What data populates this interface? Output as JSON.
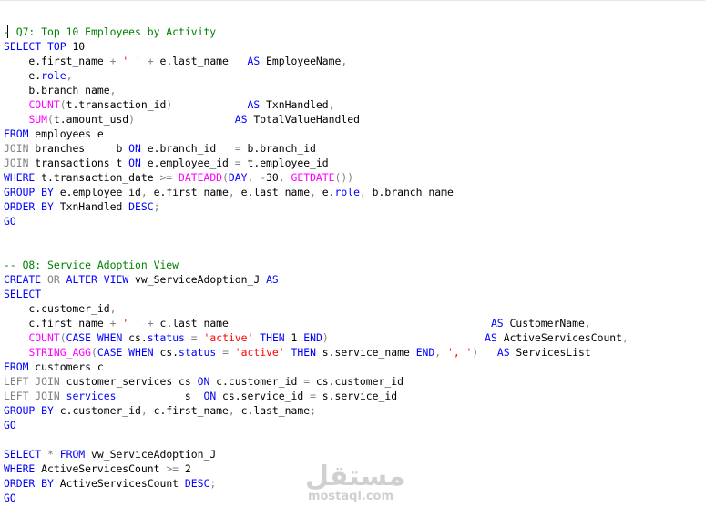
{
  "editor": {
    "watermark": {
      "mark": "مستقل",
      "text": "mostaql.com"
    },
    "lines": [
      [
        {
          "t": "- Q7: Top 10 Employees by Activity",
          "c": "cm"
        }
      ],
      [
        {
          "t": "SELECT",
          "c": "kw"
        },
        {
          "t": " ",
          "c": "tx"
        },
        {
          "t": "TOP",
          "c": "kw"
        },
        {
          "t": " 10",
          "c": "tx"
        }
      ],
      [
        {
          "t": "    e.first_name ",
          "c": "tx"
        },
        {
          "t": "+",
          "c": "op"
        },
        {
          "t": " ",
          "c": "tx"
        },
        {
          "t": "' '",
          "c": "str"
        },
        {
          "t": " ",
          "c": "tx"
        },
        {
          "t": "+",
          "c": "op"
        },
        {
          "t": " e.last_name   ",
          "c": "tx"
        },
        {
          "t": "AS",
          "c": "kw"
        },
        {
          "t": " EmployeeName",
          "c": "tx"
        },
        {
          "t": ",",
          "c": "op"
        }
      ],
      [
        {
          "t": "    e.",
          "c": "tx"
        },
        {
          "t": "role",
          "c": "kw"
        },
        {
          "t": ",",
          "c": "op"
        }
      ],
      [
        {
          "t": "    b.branch_name",
          "c": "tx"
        },
        {
          "t": ",",
          "c": "op"
        }
      ],
      [
        {
          "t": "    ",
          "c": "tx"
        },
        {
          "t": "COUNT",
          "c": "fn"
        },
        {
          "t": "(",
          "c": "op"
        },
        {
          "t": "t.transaction_id",
          "c": "tx"
        },
        {
          "t": ")",
          "c": "op"
        },
        {
          "t": "            ",
          "c": "tx"
        },
        {
          "t": "AS",
          "c": "kw"
        },
        {
          "t": " TxnHandled",
          "c": "tx"
        },
        {
          "t": ",",
          "c": "op"
        }
      ],
      [
        {
          "t": "    ",
          "c": "tx"
        },
        {
          "t": "SUM",
          "c": "fn"
        },
        {
          "t": "(",
          "c": "op"
        },
        {
          "t": "t.amount_usd",
          "c": "tx"
        },
        {
          "t": ")",
          "c": "op"
        },
        {
          "t": "                ",
          "c": "tx"
        },
        {
          "t": "AS",
          "c": "kw"
        },
        {
          "t": " TotalValueHandled",
          "c": "tx"
        }
      ],
      [
        {
          "t": "FROM",
          "c": "kw"
        },
        {
          "t": " employees e",
          "c": "tx"
        }
      ],
      [
        {
          "t": "JOIN",
          "c": "op"
        },
        {
          "t": " branches     b ",
          "c": "tx"
        },
        {
          "t": "ON",
          "c": "kw"
        },
        {
          "t": " e.branch_id   ",
          "c": "tx"
        },
        {
          "t": "=",
          "c": "op"
        },
        {
          "t": " b.branch_id",
          "c": "tx"
        }
      ],
      [
        {
          "t": "JOIN",
          "c": "op"
        },
        {
          "t": " transactions t ",
          "c": "tx"
        },
        {
          "t": "ON",
          "c": "kw"
        },
        {
          "t": " e.employee_id ",
          "c": "tx"
        },
        {
          "t": "=",
          "c": "op"
        },
        {
          "t": " t.employee_id",
          "c": "tx"
        }
      ],
      [
        {
          "t": "WHERE",
          "c": "kw"
        },
        {
          "t": " t.transaction_date ",
          "c": "tx"
        },
        {
          "t": ">=",
          "c": "op"
        },
        {
          "t": " ",
          "c": "tx"
        },
        {
          "t": "DATEADD",
          "c": "fn"
        },
        {
          "t": "(",
          "c": "op"
        },
        {
          "t": "DAY",
          "c": "kw"
        },
        {
          "t": ",",
          "c": "op"
        },
        {
          "t": " ",
          "c": "tx"
        },
        {
          "t": "-",
          "c": "op"
        },
        {
          "t": "30",
          "c": "tx"
        },
        {
          "t": ",",
          "c": "op"
        },
        {
          "t": " ",
          "c": "tx"
        },
        {
          "t": "GETDATE",
          "c": "fn"
        },
        {
          "t": "())",
          "c": "op"
        }
      ],
      [
        {
          "t": "GROUP",
          "c": "kw"
        },
        {
          "t": " ",
          "c": "tx"
        },
        {
          "t": "BY",
          "c": "kw"
        },
        {
          "t": " e.employee_id",
          "c": "tx"
        },
        {
          "t": ",",
          "c": "op"
        },
        {
          "t": " e.first_name",
          "c": "tx"
        },
        {
          "t": ",",
          "c": "op"
        },
        {
          "t": " e.last_name",
          "c": "tx"
        },
        {
          "t": ",",
          "c": "op"
        },
        {
          "t": " e.",
          "c": "tx"
        },
        {
          "t": "role",
          "c": "kw"
        },
        {
          "t": ",",
          "c": "op"
        },
        {
          "t": " b.branch_name",
          "c": "tx"
        }
      ],
      [
        {
          "t": "ORDER",
          "c": "kw"
        },
        {
          "t": " ",
          "c": "tx"
        },
        {
          "t": "BY",
          "c": "kw"
        },
        {
          "t": " TxnHandled ",
          "c": "tx"
        },
        {
          "t": "DESC",
          "c": "kw"
        },
        {
          "t": ";",
          "c": "op"
        }
      ],
      [
        {
          "t": "GO",
          "c": "kw"
        }
      ],
      [],
      [],
      [
        {
          "t": "-- Q8: Service Adoption View",
          "c": "cm"
        }
      ],
      [
        {
          "t": "CREATE",
          "c": "kw"
        },
        {
          "t": " ",
          "c": "tx"
        },
        {
          "t": "OR",
          "c": "op"
        },
        {
          "t": " ",
          "c": "tx"
        },
        {
          "t": "ALTER",
          "c": "kw"
        },
        {
          "t": " ",
          "c": "tx"
        },
        {
          "t": "VIEW",
          "c": "kw"
        },
        {
          "t": " vw_ServiceAdoption_J ",
          "c": "tx"
        },
        {
          "t": "AS",
          "c": "kw"
        }
      ],
      [
        {
          "t": "SELECT",
          "c": "kw"
        }
      ],
      [
        {
          "t": "    c.customer_id",
          "c": "tx"
        },
        {
          "t": ",",
          "c": "op"
        }
      ],
      [
        {
          "t": "    c.first_name ",
          "c": "tx"
        },
        {
          "t": "+",
          "c": "op"
        },
        {
          "t": " ",
          "c": "tx"
        },
        {
          "t": "' '",
          "c": "str"
        },
        {
          "t": " ",
          "c": "tx"
        },
        {
          "t": "+",
          "c": "op"
        },
        {
          "t": " c.last_name                                          ",
          "c": "tx"
        },
        {
          "t": "AS",
          "c": "kw"
        },
        {
          "t": " CustomerName",
          "c": "tx"
        },
        {
          "t": ",",
          "c": "op"
        }
      ],
      [
        {
          "t": "    ",
          "c": "tx"
        },
        {
          "t": "COUNT",
          "c": "fn"
        },
        {
          "t": "(",
          "c": "op"
        },
        {
          "t": "CASE",
          "c": "kw"
        },
        {
          "t": " ",
          "c": "tx"
        },
        {
          "t": "WHEN",
          "c": "kw"
        },
        {
          "t": " cs.",
          "c": "tx"
        },
        {
          "t": "status",
          "c": "kw"
        },
        {
          "t": " ",
          "c": "tx"
        },
        {
          "t": "=",
          "c": "op"
        },
        {
          "t": " ",
          "c": "tx"
        },
        {
          "t": "'active'",
          "c": "str"
        },
        {
          "t": " ",
          "c": "tx"
        },
        {
          "t": "THEN",
          "c": "kw"
        },
        {
          "t": " 1 ",
          "c": "tx"
        },
        {
          "t": "END",
          "c": "kw"
        },
        {
          "t": ")",
          "c": "op"
        },
        {
          "t": "                         ",
          "c": "tx"
        },
        {
          "t": "AS",
          "c": "kw"
        },
        {
          "t": " ActiveServicesCount",
          "c": "tx"
        },
        {
          "t": ",",
          "c": "op"
        }
      ],
      [
        {
          "t": "    ",
          "c": "tx"
        },
        {
          "t": "STRING_AGG",
          "c": "fn"
        },
        {
          "t": "(",
          "c": "op"
        },
        {
          "t": "CASE",
          "c": "kw"
        },
        {
          "t": " ",
          "c": "tx"
        },
        {
          "t": "WHEN",
          "c": "kw"
        },
        {
          "t": " cs.",
          "c": "tx"
        },
        {
          "t": "status",
          "c": "kw"
        },
        {
          "t": " ",
          "c": "tx"
        },
        {
          "t": "=",
          "c": "op"
        },
        {
          "t": " ",
          "c": "tx"
        },
        {
          "t": "'active'",
          "c": "str"
        },
        {
          "t": " ",
          "c": "tx"
        },
        {
          "t": "THEN",
          "c": "kw"
        },
        {
          "t": " s.service_name ",
          "c": "tx"
        },
        {
          "t": "END",
          "c": "kw"
        },
        {
          "t": ",",
          "c": "op"
        },
        {
          "t": " ",
          "c": "tx"
        },
        {
          "t": "', '",
          "c": "str"
        },
        {
          "t": ")",
          "c": "op"
        },
        {
          "t": "   ",
          "c": "tx"
        },
        {
          "t": "AS",
          "c": "kw"
        },
        {
          "t": " ServicesList",
          "c": "tx"
        }
      ],
      [
        {
          "t": "FROM",
          "c": "kw"
        },
        {
          "t": " customers c",
          "c": "tx"
        }
      ],
      [
        {
          "t": "LEFT",
          "c": "op"
        },
        {
          "t": " ",
          "c": "tx"
        },
        {
          "t": "JOIN",
          "c": "op"
        },
        {
          "t": " customer_services cs ",
          "c": "tx"
        },
        {
          "t": "ON",
          "c": "kw"
        },
        {
          "t": " c.customer_id ",
          "c": "tx"
        },
        {
          "t": "=",
          "c": "op"
        },
        {
          "t": " cs.customer_id",
          "c": "tx"
        }
      ],
      [
        {
          "t": "LEFT",
          "c": "op"
        },
        {
          "t": " ",
          "c": "tx"
        },
        {
          "t": "JOIN",
          "c": "op"
        },
        {
          "t": " ",
          "c": "tx"
        },
        {
          "t": "services",
          "c": "kw"
        },
        {
          "t": "           s  ",
          "c": "tx"
        },
        {
          "t": "ON",
          "c": "kw"
        },
        {
          "t": " cs.service_id ",
          "c": "tx"
        },
        {
          "t": "=",
          "c": "op"
        },
        {
          "t": " s.service_id",
          "c": "tx"
        }
      ],
      [
        {
          "t": "GROUP",
          "c": "kw"
        },
        {
          "t": " ",
          "c": "tx"
        },
        {
          "t": "BY",
          "c": "kw"
        },
        {
          "t": " c.customer_id",
          "c": "tx"
        },
        {
          "t": ",",
          "c": "op"
        },
        {
          "t": " c.first_name",
          "c": "tx"
        },
        {
          "t": ",",
          "c": "op"
        },
        {
          "t": " c.last_name",
          "c": "tx"
        },
        {
          "t": ";",
          "c": "op"
        }
      ],
      [
        {
          "t": "GO",
          "c": "kw"
        }
      ],
      [],
      [
        {
          "t": "SELECT",
          "c": "kw"
        },
        {
          "t": " ",
          "c": "tx"
        },
        {
          "t": "*",
          "c": "op"
        },
        {
          "t": " ",
          "c": "tx"
        },
        {
          "t": "FROM",
          "c": "kw"
        },
        {
          "t": " vw_ServiceAdoption_J",
          "c": "tx"
        }
      ],
      [
        {
          "t": "WHERE",
          "c": "kw"
        },
        {
          "t": " ActiveServicesCount ",
          "c": "tx"
        },
        {
          "t": ">=",
          "c": "op"
        },
        {
          "t": " 2",
          "c": "tx"
        }
      ],
      [
        {
          "t": "ORDER",
          "c": "kw"
        },
        {
          "t": " ",
          "c": "tx"
        },
        {
          "t": "BY",
          "c": "kw"
        },
        {
          "t": " ActiveServicesCount ",
          "c": "tx"
        },
        {
          "t": "DESC",
          "c": "kw"
        },
        {
          "t": ";",
          "c": "op"
        }
      ],
      [
        {
          "t": "GO",
          "c": "kw"
        }
      ]
    ]
  }
}
